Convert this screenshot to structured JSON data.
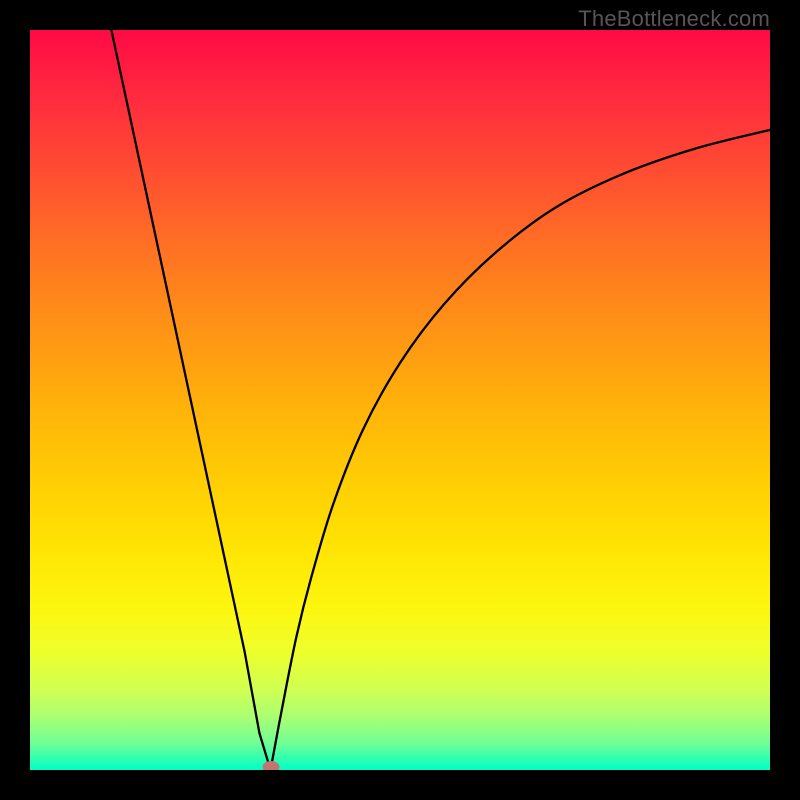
{
  "source_label": "TheBottleneck.com",
  "colors": {
    "background": "#000000",
    "curve": "#000000",
    "marker": "#c4746f",
    "label": "#565656"
  },
  "chart_data": {
    "type": "line",
    "title": "",
    "xlabel": "",
    "ylabel": "",
    "xlim": [
      0,
      100
    ],
    "ylim": [
      0,
      100
    ],
    "left_branch": {
      "x": [
        11,
        14,
        17,
        20,
        23,
        26,
        29,
        31,
        32.5
      ],
      "values": [
        100,
        86,
        72,
        58,
        44,
        30,
        16,
        5,
        0
      ]
    },
    "right_branch": {
      "x": [
        32.5,
        34,
        36,
        38,
        41,
        45,
        50,
        56,
        63,
        71,
        80,
        90,
        100
      ],
      "values": [
        0,
        8,
        18,
        26,
        36,
        46,
        55,
        63,
        70,
        76,
        80.5,
        84,
        86.5
      ]
    },
    "marker": {
      "x": 32.5,
      "y": 0
    },
    "background_gradient": {
      "stops": [
        {
          "pos": 0,
          "color": "#ff0a45"
        },
        {
          "pos": 0.5,
          "color": "#ffb00a"
        },
        {
          "pos": 0.8,
          "color": "#fdf60e"
        },
        {
          "pos": 1.0,
          "color": "#00ffc8"
        }
      ]
    }
  }
}
